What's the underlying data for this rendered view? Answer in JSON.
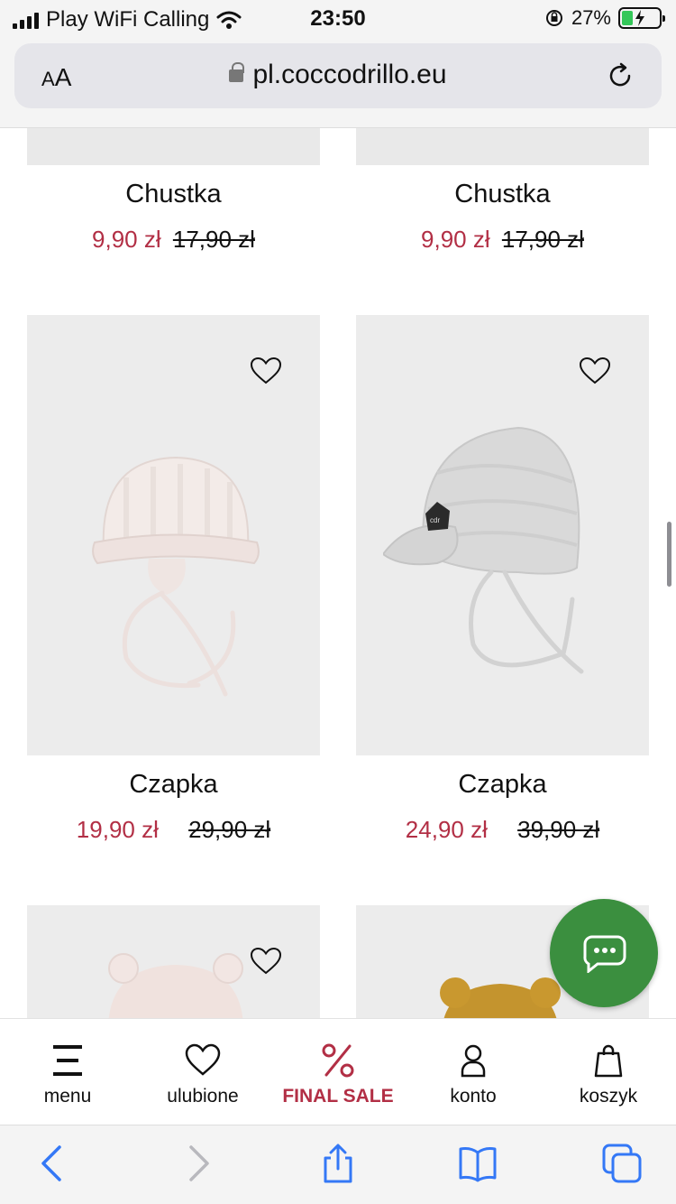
{
  "status_bar": {
    "carrier": "Play WiFi Calling",
    "time": "23:50",
    "battery": "27%"
  },
  "browser": {
    "aa_label_small": "A",
    "aa_label_large": "A",
    "url": "pl.coccodrillo.eu"
  },
  "products": [
    {
      "name": "Chustka",
      "price": "9,90 zł",
      "old_price": "17,90 zł"
    },
    {
      "name": "Chustka",
      "price": "9,90 zł",
      "old_price": "17,90 zł"
    },
    {
      "name": "Czapka",
      "price": "19,90 zł",
      "old_price": "29,90 zł"
    },
    {
      "name": "Czapka",
      "price": "24,90 zł",
      "old_price": "39,90 zł"
    }
  ],
  "bottom_nav": {
    "menu": "menu",
    "favorites": "ulubione",
    "final_sale": "FINAL SALE",
    "account": "konto",
    "cart": "koszyk"
  },
  "colors": {
    "sale_red": "#b22f45",
    "chat_green": "#3b8f3f",
    "safari_blue": "#3478f6"
  }
}
